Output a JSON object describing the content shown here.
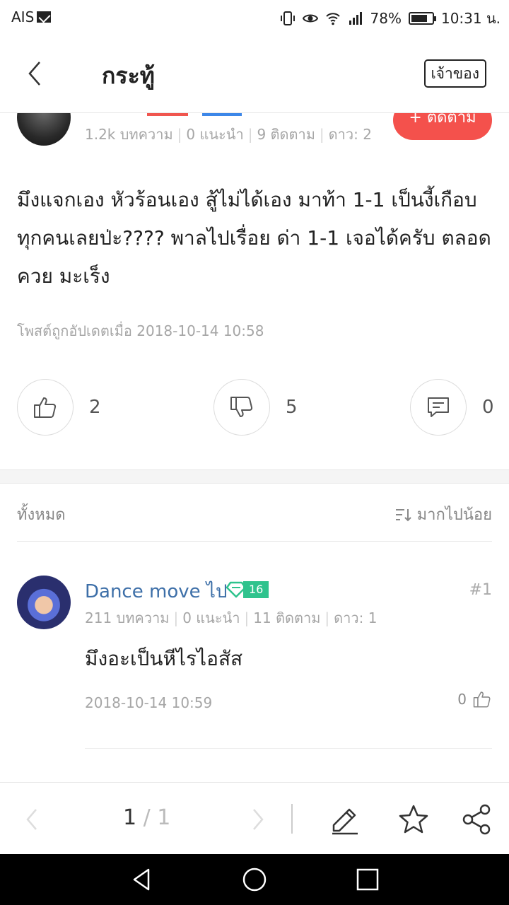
{
  "status_bar": {
    "carrier": "AIS",
    "battery_percent": "78%",
    "battery_level": 0.78,
    "time": "10:31 น."
  },
  "header": {
    "title": "กระทู้",
    "owner_button": "เจ้าของ"
  },
  "author": {
    "stats": {
      "articles": "1.2k บทความ",
      "recommend": "0 แนะนำ",
      "following": "9 ติดตาม",
      "stars": "ดาว: 2"
    },
    "follow_button": "+ ติดตาม"
  },
  "post": {
    "body": "มึงแจกเอง หัวร้อนเอง สู้ไม่ได้เอง มาท้า 1-1 เป็นงี้เกือบทุกคนเลยป่ะ???? พาลไปเรื่อย ด่า 1-1 เจอได้ครับ ตลอด ควย มะเร็ง",
    "updated": "โพสต์ถูกอัปเดตเมื่อ 2018-10-14 10:58",
    "likes": "2",
    "dislikes": "5",
    "comments": "0"
  },
  "filter": {
    "all_label": "ทั้งหมด",
    "sort_label": "มากไปน้อย"
  },
  "comments": [
    {
      "name": "Dance move ไป",
      "level": "16",
      "number": "#1",
      "stats": {
        "articles": "211 บทความ",
        "recommend": "0 แนะนำ",
        "following": "11 ติดตาม",
        "stars": "ดาว: 1"
      },
      "text": "มึงอะเป็นหีไรไอสัส",
      "date": "2018-10-14 10:59",
      "likes": "0"
    }
  ],
  "pagination": {
    "current": "1",
    "separator": "/",
    "total": "1"
  },
  "icons": {
    "back": "chevron-left-icon",
    "like": "thumbs-up-icon",
    "dislike": "thumbs-down-icon",
    "comment": "comment-icon",
    "sort": "sort-icon",
    "edit": "pencil-icon",
    "favorite": "star-icon",
    "share": "share-icon"
  },
  "colors": {
    "accent_red": "#f4514c",
    "link_blue": "#3d6fa8",
    "level_green": "#2fc38d"
  }
}
